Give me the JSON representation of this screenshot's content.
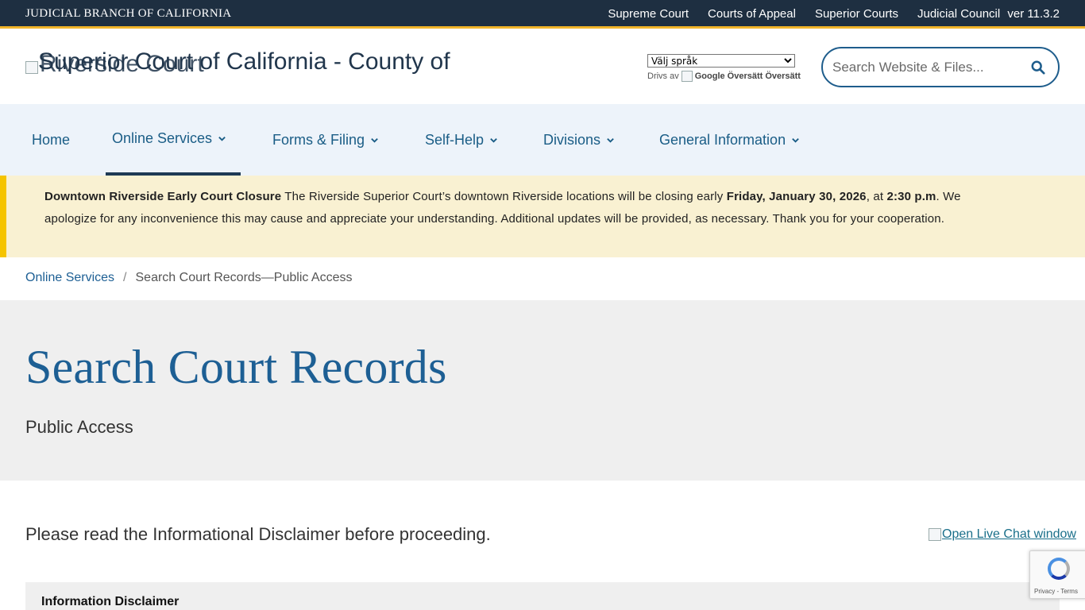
{
  "topbar": {
    "brand": "JUDICIAL BRANCH OF CALIFORNIA",
    "links": [
      "Supreme Court",
      "Courts of Appeal",
      "Superior Courts",
      "Judicial Council"
    ],
    "version": "ver 11.3.2"
  },
  "header": {
    "logo_alt_a": "Superior Court of California - County of",
    "logo_alt_b": "Riverside Court",
    "translate": {
      "select_value": "Välj språk",
      "powered_by": "Drivs av",
      "google_alt": "Google Översätt",
      "translate_label": "Översätt"
    },
    "search": {
      "placeholder": "Search Website & Files..."
    }
  },
  "nav": {
    "home": "Home",
    "online_services": "Online Services",
    "forms_filing": "Forms & Filing",
    "self_help": "Self-Help",
    "divisions": "Divisions",
    "general_info": "General Information"
  },
  "alert": {
    "title": "Downtown Riverside Early Court Closure",
    "text1": " The Riverside Superior Court’s downtown Riverside locations will be closing early ",
    "date": "Friday, January 30, 2026",
    "text2": ", at ",
    "time": "2:30 p.m",
    "text3": ". We apologize for any inconvenience this may cause and appreciate your understanding. Additional updates will be provided, as necessary. Thank you for your cooperation."
  },
  "breadcrumb": {
    "parent": "Online Services",
    "separator": "/",
    "current": "Search Court Records—Public Access"
  },
  "hero": {
    "title": "Search Court Records",
    "subtitle": "Public Access"
  },
  "content": {
    "intro": "Please read the Informational Disclaimer before proceeding.",
    "chat_link": "Open Live Chat window",
    "disclaimer_title": "Information Disclaimer"
  },
  "recaptcha": {
    "text": "Privacy - Terms"
  },
  "colors": {
    "topbar_bg": "#1e2f41",
    "accent_gold": "#f2b52a",
    "nav_bg": "#edf3fa",
    "link_blue": "#1d5f94",
    "alert_bg": "#f9f1d2",
    "alert_border": "#f5c400"
  }
}
